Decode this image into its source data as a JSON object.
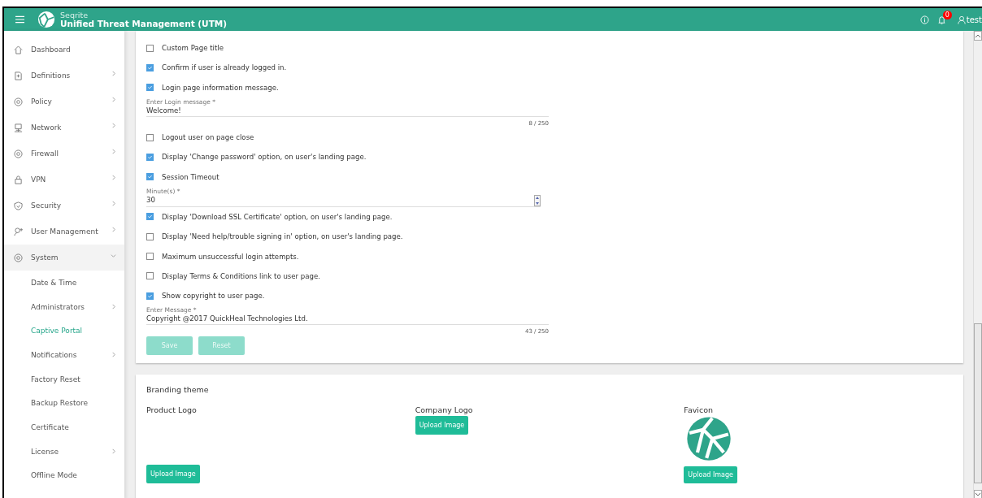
{
  "header": {
    "brand": "Seqrite",
    "title": "Unified Threat Management (UTM)",
    "notification_count": "0",
    "user": "test"
  },
  "sidebar": {
    "items": [
      {
        "label": "Dashboard",
        "expandable": false,
        "expanded": false
      },
      {
        "label": "Definitions",
        "expandable": true,
        "expanded": false
      },
      {
        "label": "Policy",
        "expandable": true,
        "expanded": false
      },
      {
        "label": "Network",
        "expandable": true,
        "expanded": false
      },
      {
        "label": "Firewall",
        "expandable": true,
        "expanded": false
      },
      {
        "label": "VPN",
        "expandable": true,
        "expanded": false
      },
      {
        "label": "Security",
        "expandable": true,
        "expanded": false
      },
      {
        "label": "User Management",
        "expandable": true,
        "expanded": false
      },
      {
        "label": "System",
        "expandable": true,
        "expanded": true,
        "children": [
          {
            "label": "Date & Time",
            "expandable": false,
            "selected": false
          },
          {
            "label": "Administrators",
            "expandable": true,
            "selected": false
          },
          {
            "label": "Captive Portal",
            "expandable": false,
            "selected": true
          },
          {
            "label": "Notifications",
            "expandable": true,
            "selected": false
          },
          {
            "label": "Factory Reset",
            "expandable": false,
            "selected": false
          },
          {
            "label": "Backup Restore",
            "expandable": false,
            "selected": false
          },
          {
            "label": "Certificate",
            "expandable": false,
            "selected": false
          },
          {
            "label": "License",
            "expandable": true,
            "selected": false
          },
          {
            "label": "Offline Mode",
            "expandable": false,
            "selected": false
          }
        ]
      }
    ]
  },
  "settings": {
    "options": [
      {
        "kind": "checkbox",
        "label": "Custom Page title",
        "checked": false
      },
      {
        "kind": "checkbox",
        "label": "Confirm if user is already logged in.",
        "checked": true
      },
      {
        "kind": "checkbox",
        "label": "Login page information message.",
        "checked": true
      },
      {
        "kind": "text",
        "label": "Enter Login message *",
        "value": "Welcome!",
        "counter": "8 / 250"
      },
      {
        "kind": "checkbox",
        "label": "Logout user on page close",
        "checked": false
      },
      {
        "kind": "checkbox",
        "label": "Display 'Change password' option, on user's landing page.",
        "checked": true
      },
      {
        "kind": "checkbox",
        "label": "Session Timeout",
        "checked": true
      },
      {
        "kind": "number",
        "label": "Minute(s) *",
        "value": "30"
      },
      {
        "kind": "checkbox",
        "label": "Display 'Download SSL Certificate' option, on user's landing page.",
        "checked": true
      },
      {
        "kind": "checkbox",
        "label": "Display 'Need help/trouble signing in' option, on user's landing page.",
        "checked": false
      },
      {
        "kind": "checkbox",
        "label": "Maximum unsuccessful login attempts.",
        "checked": false
      },
      {
        "kind": "checkbox",
        "label": "Display Terms & Conditions link to user page.",
        "checked": false
      },
      {
        "kind": "checkbox",
        "label": "Show copyright to user page.",
        "checked": true
      },
      {
        "kind": "text",
        "label": "Enter Message *",
        "value": "Copyright @2017 QuickHeal Technologies Ltd.",
        "counter": "43 / 250"
      }
    ],
    "buttons": [
      {
        "label": "Save",
        "disabled": true
      },
      {
        "label": "Reset",
        "disabled": true
      }
    ]
  },
  "branding": {
    "title": "Branding theme",
    "slots": [
      {
        "kind": "empty",
        "label": "Product Logo",
        "button": "Upload Image"
      },
      {
        "kind": "compact",
        "label": "Company Logo",
        "button": "Upload Image"
      },
      {
        "kind": "image",
        "label": "Favicon",
        "button": "Upload Image"
      }
    ]
  }
}
